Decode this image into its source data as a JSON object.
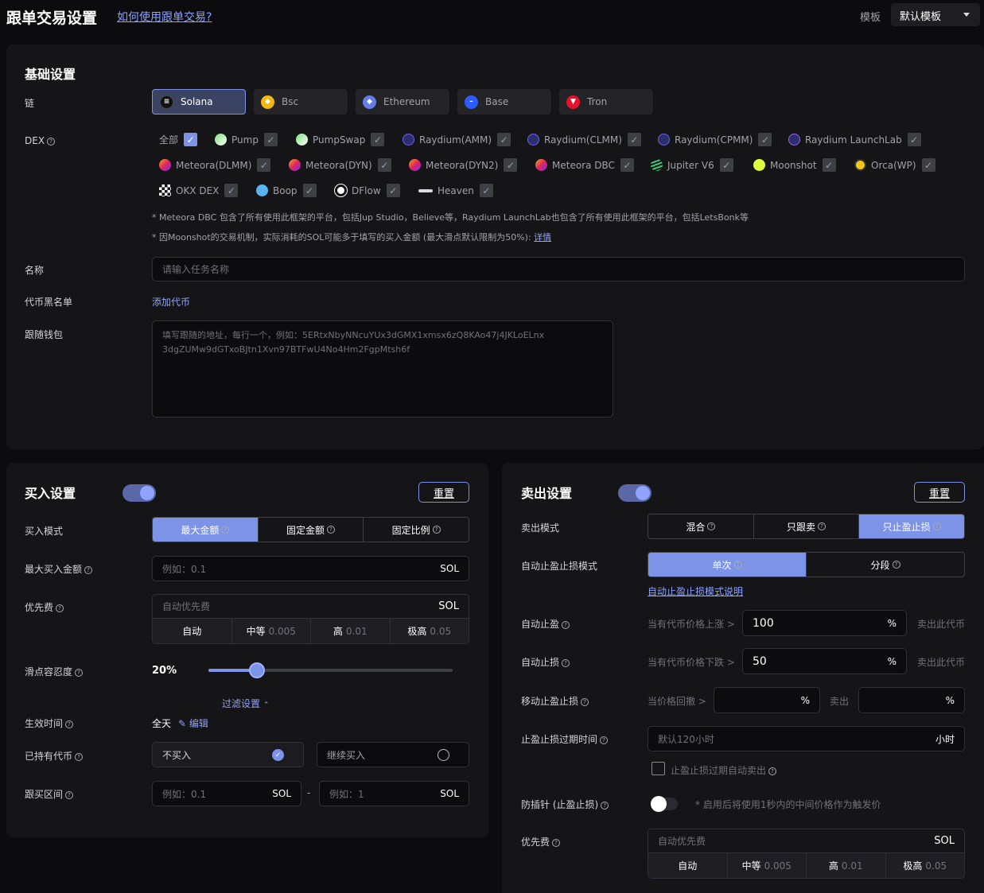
{
  "header": {
    "title": "跟单交易设置",
    "howto": "如何使用跟单交易?",
    "template_label": "模板",
    "template_value": "默认模板"
  },
  "basic": {
    "title": "基础设置",
    "chain_label": "链",
    "chains": [
      {
        "name": "Solana",
        "color": "#111"
      },
      {
        "name": "Bsc",
        "color": "#f0b90b"
      },
      {
        "name": "Ethereum",
        "color": "#627eea"
      },
      {
        "name": "Base",
        "color": "#2d5bff"
      },
      {
        "name": "Tron",
        "color": "#e8112d"
      }
    ],
    "dex_label": "DEX",
    "dex_all": "全部",
    "dex_row1": [
      "Pump",
      "PumpSwap",
      "Raydium(AMM)",
      "Raydium(CLMM)",
      "Raydium(CPMM)",
      "Raydium LaunchLab"
    ],
    "dex_row2": [
      "Meteora(DLMM)",
      "Meteora(DYN)",
      "Meteora(DYN2)",
      "Meteora DBC",
      "Jupiter V6",
      "Moonshot",
      "Orca(WP)"
    ],
    "dex_row3": [
      "OKX DEX",
      "Boop",
      "DFlow",
      "Heaven"
    ],
    "note1": "* Meteora DBC 包含了所有使用此框架的平台，包括Jup Studio，Believe等，Raydium LaunchLab也包含了所有使用此框架的平台，包括LetsBonk等",
    "note2": "* 因Moonshot的交易机制，实际消耗的SOL可能多于填写的买入金额 (最大滑点默认限制为50%):",
    "note2_link": "详情",
    "name_label": "名称",
    "name_placeholder": "请输入任务名称",
    "blacklist_label": "代币黑名单",
    "blacklist_add": "添加代币",
    "wallet_label": "跟随钱包",
    "wallet_placeholder": "填写跟随的地址，每行一个，例如：5ERtxNbyNNcuYUx3dGMX1xmsx6zQ8KAo47j4JKLoELnx\n3dgZUMw9dGTxoBJtn1Xvn97BTFwU4No4Hm2FgpMtsh6f"
  },
  "buy": {
    "title": "买入设置",
    "reset": "重置",
    "mode_label": "买入模式",
    "modes": [
      "最大金额",
      "固定金额",
      "固定比例"
    ],
    "max_label": "最大买入金额",
    "max_placeholder": "例如：0.1",
    "unit": "SOL",
    "prio_label": "优先费",
    "prio_placeholder": "自动优先费",
    "prio_opts": [
      {
        "l": "自动",
        "v": ""
      },
      {
        "l": "中等",
        "v": "0.005"
      },
      {
        "l": "高",
        "v": "0.01"
      },
      {
        "l": "极高",
        "v": "0.05"
      }
    ],
    "slip_label": "滑点容忍度",
    "slip_value": "20%",
    "slip_fraction": 0.2,
    "filter": "过滤设置",
    "time_label": "生效时间",
    "time_value": "全天",
    "time_edit": "编辑",
    "held_label": "已持有代币",
    "held_opt1": "不买入",
    "held_opt2": "继续买入",
    "range_label": "跟买区间",
    "range_min": "例如：0.1",
    "range_max": "例如：1",
    "range_dash": "-"
  },
  "sell": {
    "title": "卖出设置",
    "reset": "重置",
    "mode_label": "卖出模式",
    "modes": [
      "混合",
      "只跟卖",
      "只止盈止损"
    ],
    "tpsl_mode_label": "自动止盈止损模式",
    "tpsl_modes": [
      "单次",
      "分段"
    ],
    "tpsl_help": "自动止盈止损模式说明",
    "tp_label": "自动止盈",
    "tp_pre": "当有代币价格上涨 >",
    "tp_value": "100",
    "pct": "%",
    "tp_post": "卖出此代币",
    "sl_label": "自动止损",
    "sl_pre": "当有代币价格下跌 >",
    "sl_value": "50",
    "sl_post": "卖出此代币",
    "trail_label": "移动止盈止损",
    "trail_pre": "当价格回撤 >",
    "trail_mid": "卖出",
    "expire_label": "止盈止损过期时间",
    "expire_placeholder": "默认120小时",
    "expire_unit": "小时",
    "expire_check": "止盈止损过期自动卖出",
    "antipin_label": "防插针 (止盈止损)",
    "antipin_note": "* 启用后将使用1秒内的中间价格作为触发价",
    "prio_label": "优先费",
    "prio_placeholder": "自动优先费",
    "unit": "SOL",
    "prio_opts": [
      {
        "l": "自动",
        "v": ""
      },
      {
        "l": "中等",
        "v": "0.005"
      },
      {
        "l": "高",
        "v": "0.01"
      },
      {
        "l": "极高",
        "v": "0.05"
      }
    ]
  }
}
